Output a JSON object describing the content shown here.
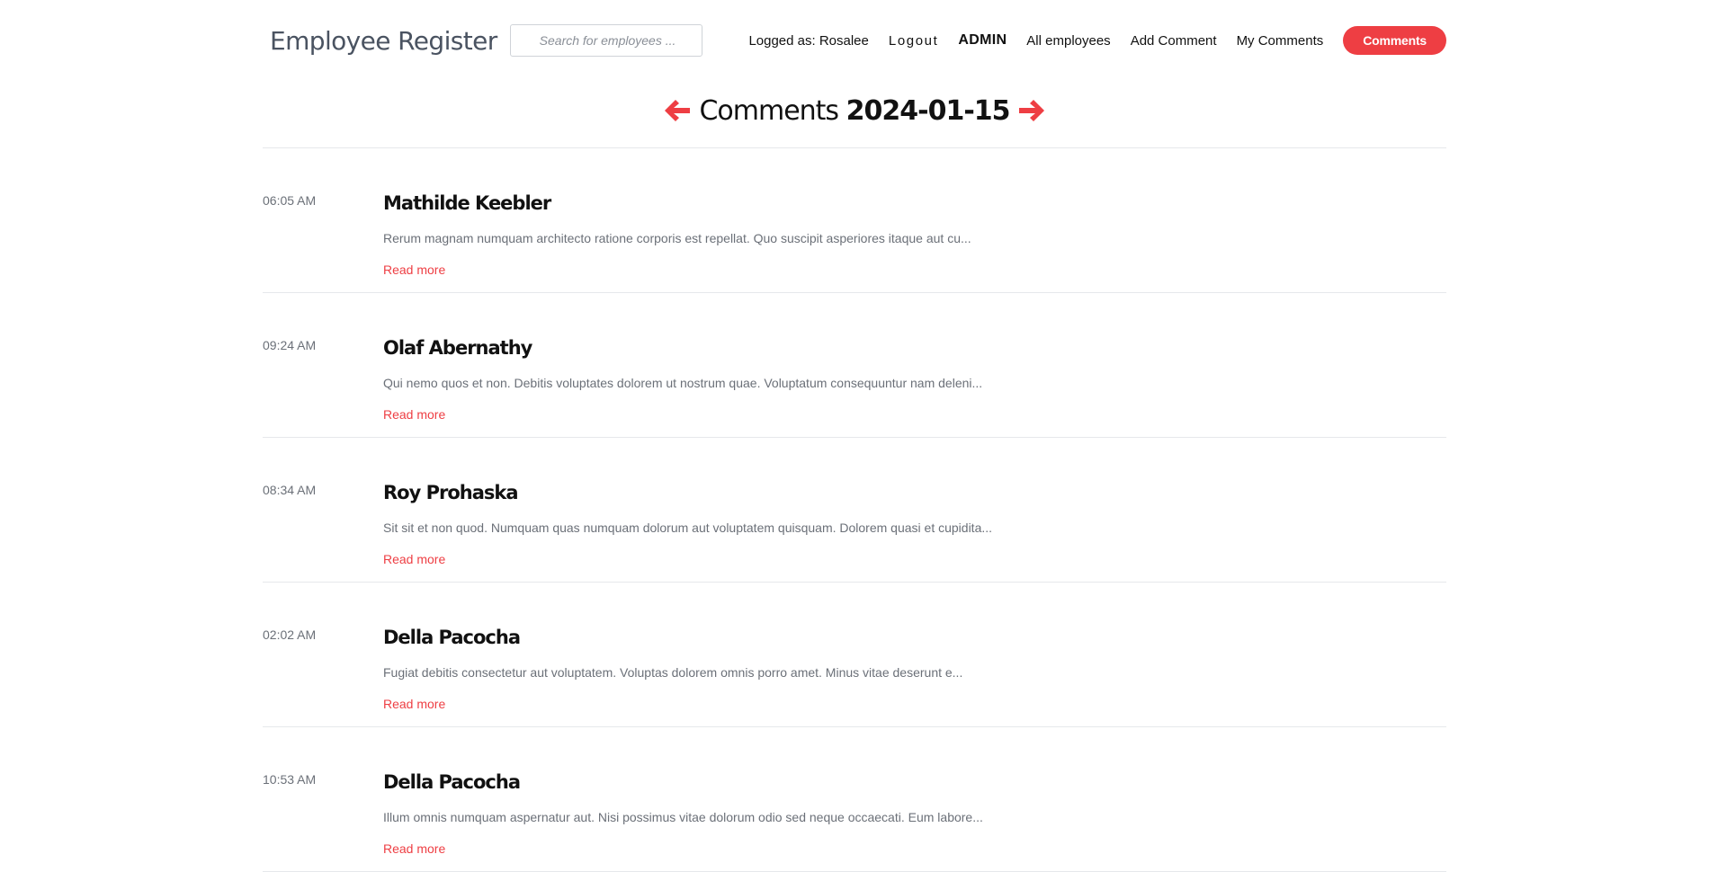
{
  "header": {
    "brand": "Employee Register",
    "search_placeholder": "Search for employees ...",
    "logged_as": "Logged as: Rosalee",
    "nav": {
      "logout": "Logout",
      "admin": "ADMIN",
      "all_employees": "All employees",
      "add_comment": "Add Comment",
      "my_comments": "My Comments",
      "comments_button": "Comments"
    }
  },
  "title": {
    "prefix": "Comments",
    "date": "2024-01-15",
    "prev_icon": "arrow-left-icon",
    "next_icon": "arrow-right-icon"
  },
  "colors": {
    "accent": "#ee3e43",
    "muted_text": "#6b7078",
    "brand_text": "#4a5361"
  },
  "comments": [
    {
      "time": "06:05 AM",
      "name": "Mathilde Keebler",
      "excerpt": "Rerum magnam numquam architecto ratione corporis est repellat. Quo suscipit asperiores itaque aut cu...",
      "read_more": "Read more"
    },
    {
      "time": "09:24 AM",
      "name": "Olaf Abernathy",
      "excerpt": "Qui nemo quos et non. Debitis voluptates dolorem ut nostrum quae. Voluptatum consequuntur nam deleni...",
      "read_more": "Read more"
    },
    {
      "time": "08:34 AM",
      "name": "Roy Prohaska",
      "excerpt": "Sit sit et non quod. Numquam quas numquam dolorum aut voluptatem quisquam. Dolorem quasi et cupidita...",
      "read_more": "Read more"
    },
    {
      "time": "02:02 AM",
      "name": "Della Pacocha",
      "excerpt": "Fugiat debitis consectetur aut voluptatem. Voluptas dolorem omnis porro amet. Minus vitae deserunt e...",
      "read_more": "Read more"
    },
    {
      "time": "10:53 AM",
      "name": "Della Pacocha",
      "excerpt": "Illum omnis numquam aspernatur aut. Nisi possimus vitae dolorum odio sed neque occaecati. Eum labore...",
      "read_more": "Read more"
    }
  ]
}
